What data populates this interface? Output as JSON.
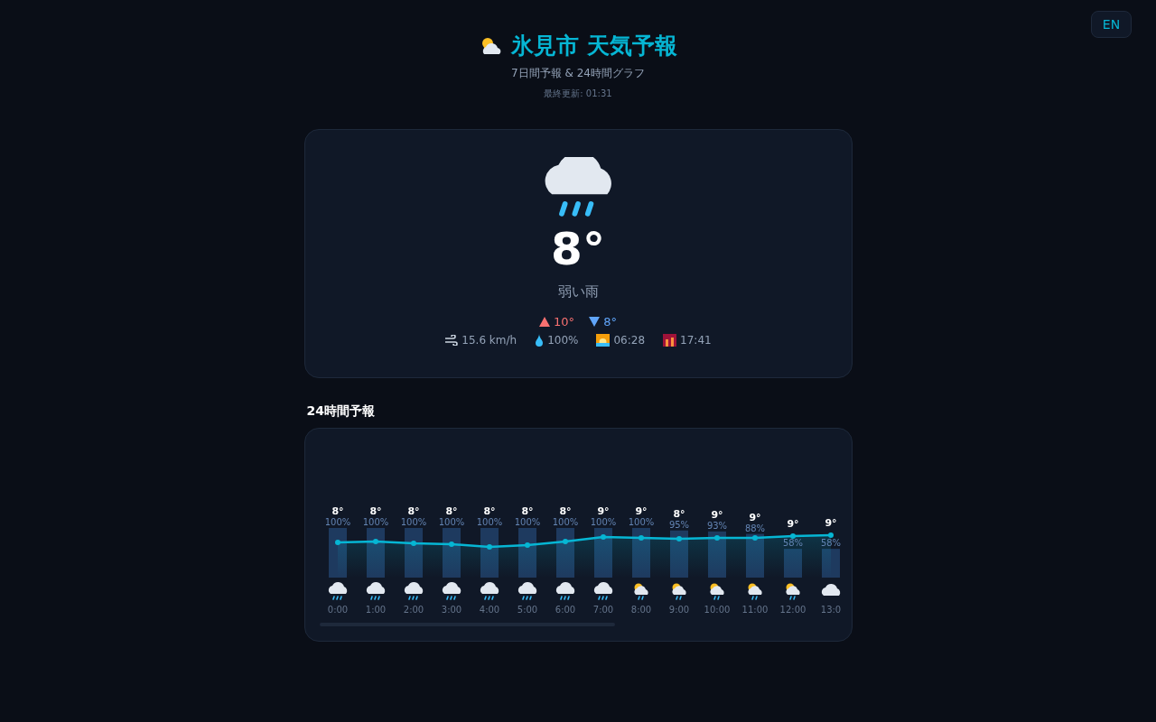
{
  "language_button": "EN",
  "header": {
    "title": "氷見市 天気予報",
    "subtitle": "7日間予報 & 24時間グラフ",
    "updated": "最終更新: 01:31"
  },
  "current": {
    "kind": "rain",
    "temperature": "8°",
    "description": "弱い雨",
    "high": "10°",
    "low": "8°",
    "wind": "15.6 km/h",
    "humidity": "100%",
    "sunrise": "06:28",
    "sunset": "17:41"
  },
  "hourly": {
    "title": "24時間予報",
    "hours": [
      {
        "time": "0:00",
        "kind": "rain",
        "temp_label": "8°",
        "precip_label": "100%",
        "level": 1.0
      },
      {
        "time": "1:00",
        "kind": "rain",
        "temp_label": "8°",
        "precip_label": "100%",
        "level": 1.0
      },
      {
        "time": "2:00",
        "kind": "rain",
        "temp_label": "8°",
        "precip_label": "100%",
        "level": 1.0
      },
      {
        "time": "3:00",
        "kind": "rain",
        "temp_label": "8°",
        "precip_label": "100%",
        "level": 1.0
      },
      {
        "time": "4:00",
        "kind": "rain",
        "temp_label": "8°",
        "precip_label": "100%",
        "level": 1.0
      },
      {
        "time": "5:00",
        "kind": "rain",
        "temp_label": "8°",
        "precip_label": "100%",
        "level": 1.0
      },
      {
        "time": "6:00",
        "kind": "rain",
        "temp_label": "8°",
        "precip_label": "100%",
        "level": 1.0
      },
      {
        "time": "7:00",
        "kind": "rain",
        "temp_label": "9°",
        "precip_label": "100%",
        "level": 1.0
      },
      {
        "time": "8:00",
        "kind": "sun_rain",
        "temp_label": "9°",
        "precip_label": "100%",
        "level": 1.0
      },
      {
        "time": "9:00",
        "kind": "sun_rain",
        "temp_label": "8°",
        "precip_label": "95%",
        "level": 0.95
      },
      {
        "time": "10:00",
        "kind": "sun_rain",
        "temp_label": "9°",
        "precip_label": "93%",
        "level": 0.93
      },
      {
        "time": "11:00",
        "kind": "sun_rain",
        "temp_label": "9°",
        "precip_label": "88%",
        "level": 0.88
      },
      {
        "time": "12:00",
        "kind": "sun_rain",
        "temp_label": "9°",
        "precip_label": "58%",
        "level": 0.58
      },
      {
        "time": "13:0",
        "kind": "cloud",
        "temp_label": "9°",
        "precip_label": "58%",
        "level": 0.58
      }
    ]
  }
}
